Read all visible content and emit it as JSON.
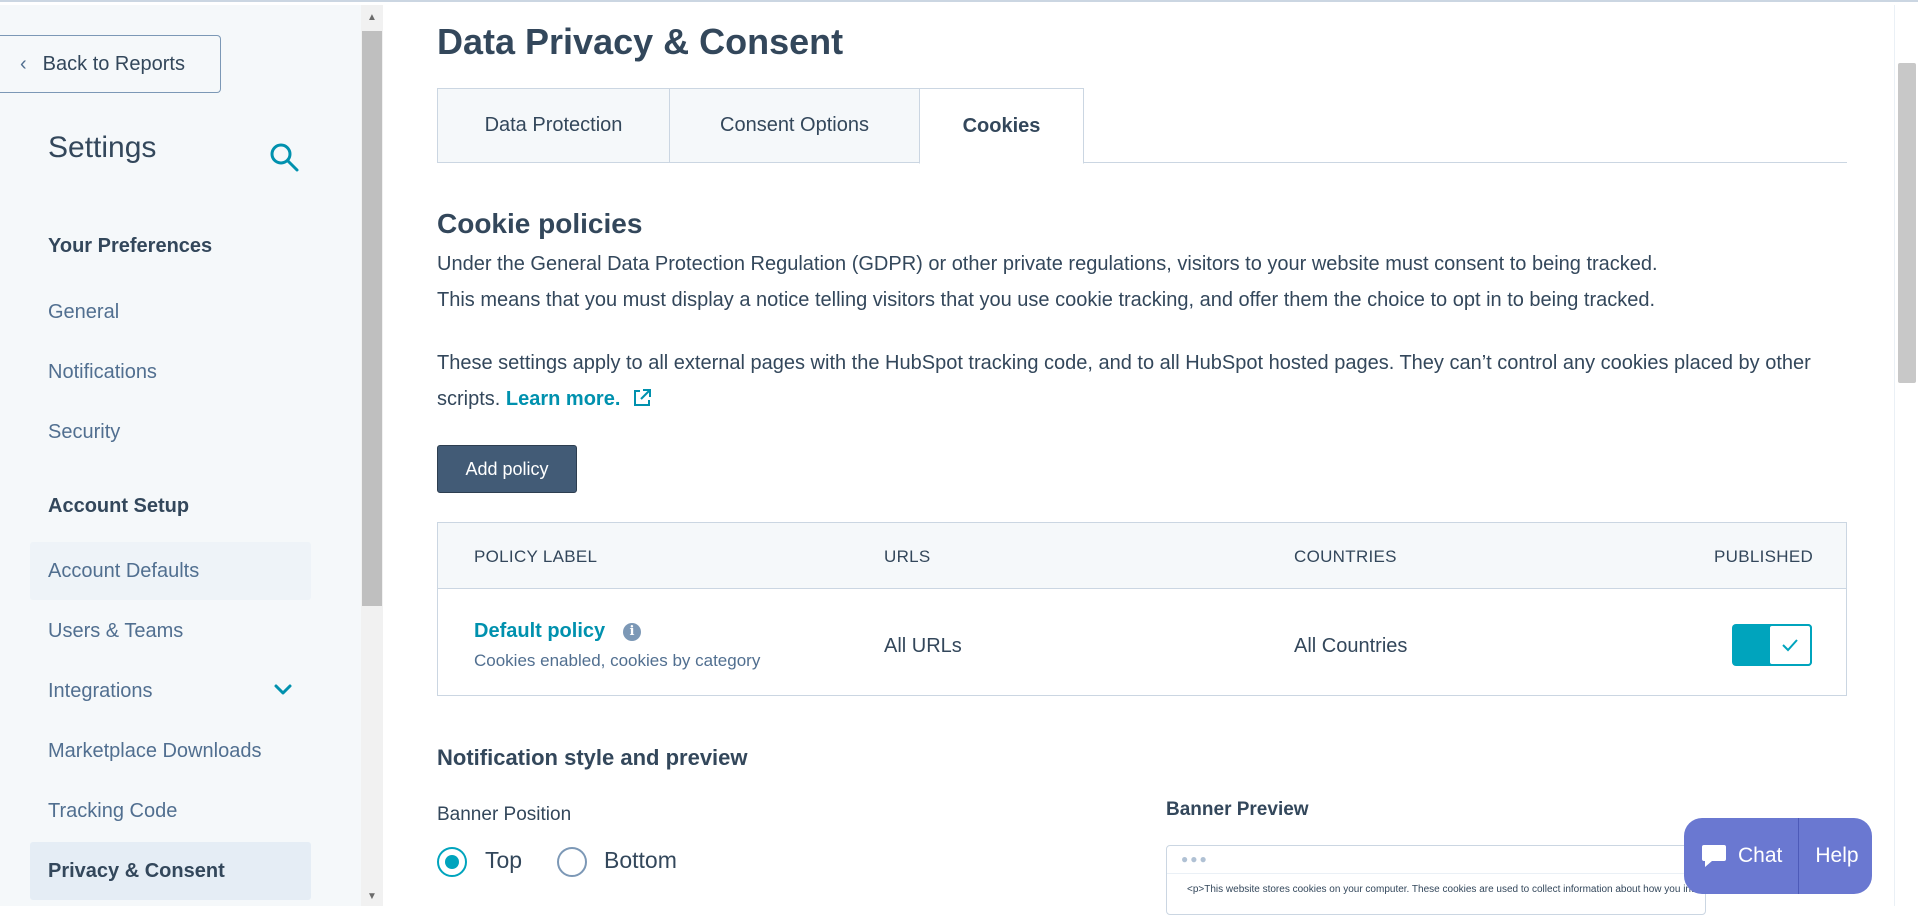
{
  "sidebar": {
    "back_label": "Back to Reports",
    "title": "Settings",
    "sections": [
      {
        "label": "Your Preferences"
      },
      {
        "label": "Account Setup"
      }
    ],
    "items": [
      {
        "label": "General"
      },
      {
        "label": "Notifications"
      },
      {
        "label": "Security"
      },
      {
        "label": "Account Defaults"
      },
      {
        "label": "Users & Teams"
      },
      {
        "label": "Integrations"
      },
      {
        "label": "Marketplace Downloads"
      },
      {
        "label": "Tracking Code"
      },
      {
        "label": "Privacy & Consent"
      }
    ]
  },
  "main": {
    "title": "Data Privacy & Consent",
    "tabs": [
      {
        "label": "Data Protection"
      },
      {
        "label": "Consent Options"
      },
      {
        "label": "Cookies"
      }
    ],
    "cookie_heading": "Cookie policies",
    "para1_line1": "Under the General Data Protection Regulation (GDPR) or other private regulations, visitors to your website must consent to being tracked.",
    "para1_line2": "This means that you must display a notice telling visitors that you use cookie tracking, and offer them the choice to opt in to being tracked.",
    "para2": "These settings apply to all external pages with the HubSpot tracking code, and to all HubSpot hosted pages. They can’t control any cookies placed by other scripts.",
    "learn_more": "Learn more.",
    "add_policy": "Add policy",
    "table": {
      "headers": [
        "POLICY LABEL",
        "URLS",
        "COUNTRIES",
        "PUBLISHED"
      ],
      "row": {
        "name": "Default policy",
        "sub": "Cookies enabled, cookies by category",
        "urls": "All URLs",
        "countries": "All Countries",
        "published": true
      }
    },
    "notif_heading": "Notification style and preview",
    "banner_position_label": "Banner Position",
    "radio_top": "Top",
    "radio_bottom": "Bottom",
    "banner_preview_label": "Banner Preview",
    "preview_text": "<p>This website stores cookies on your computer. These cookies are used to collect information about how you interact with"
  },
  "chat": {
    "chat_label": "Chat",
    "help_label": "Help"
  },
  "colors": {
    "accent": "#00a4bd",
    "link": "#0091ae",
    "button_dark": "#425b76",
    "chat": "#6a78d1"
  }
}
